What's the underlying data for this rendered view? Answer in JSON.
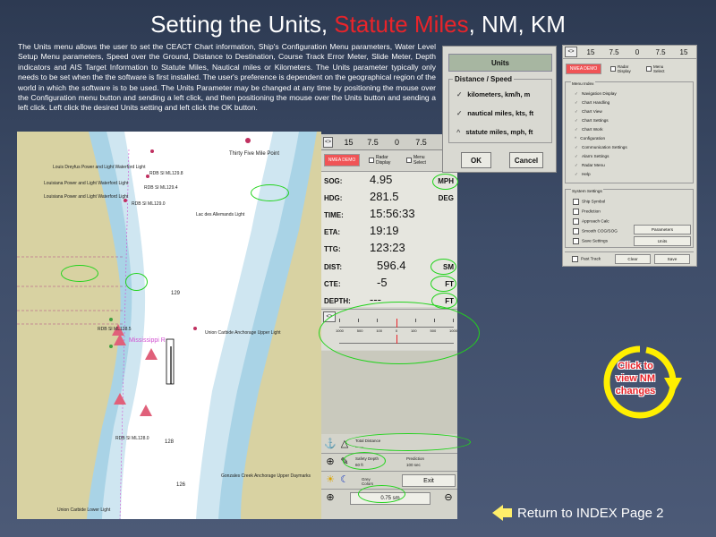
{
  "title": {
    "prefix": "Setting the Units, ",
    "highlight": "Statute Miles",
    "suffix": ", NM, KM"
  },
  "intro_text": "The Units menu allows the user to set the CEACT Chart information, Ship's Configuration Menu parameters, Water Level Setup Menu parameters, Speed over the Ground, Distance to Destination, Course Track Error Meter, Slide Meter, Depth indicators and AIS Target Information to Statute Miles, Nautical miles or Kilometers. The Units parameter typically only needs to be set when the the software is first installed. The user's preference is dependent on the geographical region of the world in which the software is to be used. The Units Parameter may be changed at any time by positioning the mouse over the Configuration menu button and sending a left click, and then positioning the mouse over the Units button and sending a left click. Left click the desired Units setting and left click the OK button.",
  "chart": {
    "point_label": "Thirty Five Mile Point",
    "labels": [
      "Louis Dreyfus Power and Light Waterford Light",
      "Louisiana Power and Light Waterford Light",
      "Louisiana Power and Light Waterford Light",
      "RDB SI ML129.8",
      "RDB SI ML129.4",
      "RDB SI ML129.0",
      "RDB SI ML128.5",
      "RDB SI ML128.0",
      "Lac des Allemands Light",
      "Union Carbide Anchorage Upper Light",
      "Mississippi R",
      "129",
      "128",
      "126",
      "Union Carbide Lower Light",
      "Gonzales Creek Anchorage Upper Daymarks"
    ]
  },
  "nav_panel": {
    "scale_left": "<>",
    "scale_values": [
      "15",
      "7.5",
      "0",
      "7.5",
      "1"
    ],
    "nmea_label": "NMEA DEMO",
    "radar_label": "Radar Display",
    "menu_label": "Menu Select",
    "rows": [
      {
        "label": "SOG:",
        "value": "4.95",
        "unit": "MPH"
      },
      {
        "label": "HDG:",
        "value": "281.5",
        "unit": "DEG"
      },
      {
        "label": "TIME:",
        "value": "15:56:33",
        "unit": ""
      },
      {
        "label": "ETA:",
        "value": "19:19",
        "unit": ""
      },
      {
        "label": "TTG:",
        "value": "123:23",
        "unit": ""
      },
      {
        "label": "DIST:",
        "value": "596.4",
        "unit": "SM"
      },
      {
        "label": "CTE:",
        "value": "-5",
        "unit": "FT"
      },
      {
        "label": "DEPTH:",
        "value": "---",
        "unit": "FT"
      }
    ],
    "slider_btn": "<>",
    "ruler_labels": [
      "1000",
      "500",
      "100",
      "0",
      "100",
      "500",
      "1000"
    ],
    "tools": {
      "total_distance_label": "Total Distance",
      "total_distance_value": "------",
      "safety_depth_label": "Safety Depth",
      "safety_depth_value": "60 ft",
      "prediction_label": "Prediction",
      "prediction_value": "100 sec",
      "colors_label": "Grey Colors",
      "exit_label": "Exit",
      "zoom_value": "0.75 sm"
    }
  },
  "units_dialog": {
    "title": "Units",
    "group_label": "Distance / Speed",
    "options": [
      {
        "label": "kilometers, km/h, m",
        "selected": false
      },
      {
        "label": "nautical miles, kts, ft",
        "selected": false
      },
      {
        "label": "statute miles, mph, ft",
        "selected": true
      }
    ],
    "ok_label": "OK",
    "cancel_label": "Cancel"
  },
  "config_panel": {
    "scale_values": [
      "15",
      "7.5",
      "0",
      "7.5",
      "15"
    ],
    "scale_left": "<>",
    "nmea_label": "NMEA DEMO",
    "radar_label": "Radar Display",
    "menu_label": "Menu Select",
    "menu_index_label": "Menu Index",
    "menu_items": [
      "Navigation Display",
      "Chart Handling",
      "Chart View",
      "Chart Settings",
      "Chart Work",
      "Configuration",
      "Communication Settings",
      "Alarm Settings",
      "Radar Menu",
      "Help"
    ],
    "system_settings_label": "System Settings",
    "system_items": [
      "Ship Symbol",
      "Prediction",
      "Approach Calc",
      "Smooth COG/SOG",
      "Save Settings"
    ],
    "parameters_btn": "Parameters",
    "units_btn": "Units",
    "past_track": "Past Track",
    "clear_btn": "Clear",
    "save_btn": "Save"
  },
  "click_nm": "Click to view NM changes",
  "return_label": "Return to INDEX Page 2",
  "colors": {
    "highlight": "#e8242a",
    "ellipse": "#22d31c",
    "button_yellow": "#ffef6a",
    "nmea": "#f05456"
  }
}
